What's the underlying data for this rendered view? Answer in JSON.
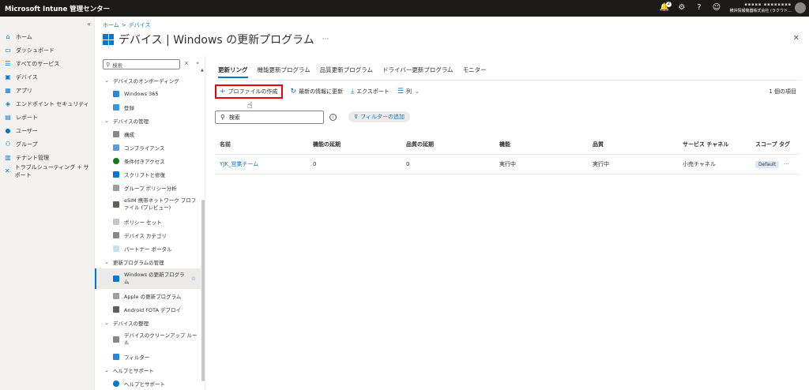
{
  "app": {
    "title": "Microsoft Intune 管理センター",
    "notification_count": "2",
    "user_line1": "▪▪▪▪▪ ▪▪▪▪▪▪▪▪",
    "user_line2": "横浜情報機器株式会社 (ラクウド…"
  },
  "left_nav": {
    "collapse": "«",
    "items": [
      {
        "label": "ホーム",
        "icon": "home-icon"
      },
      {
        "label": "ダッシュボード",
        "icon": "dashboard-icon"
      },
      {
        "label": "すべてのサービス",
        "icon": "list-icon"
      },
      {
        "label": "デバイス",
        "icon": "devices-icon"
      },
      {
        "label": "アプリ",
        "icon": "apps-icon"
      },
      {
        "label": "エンドポイント セキュリティ",
        "icon": "endpoint-security-icon"
      },
      {
        "label": "レポート",
        "icon": "reports-icon"
      },
      {
        "label": "ユーザー",
        "icon": "users-icon"
      },
      {
        "label": "グループ",
        "icon": "groups-icon"
      },
      {
        "label": "テナント管理",
        "icon": "tenant-icon"
      },
      {
        "label": "トラブルシューティング + サポート",
        "icon": "troubleshooting-icon"
      }
    ]
  },
  "breadcrumb": {
    "home": "ホーム",
    "sep": ">",
    "current": "デバイス"
  },
  "page": {
    "title": "デバイス | Windows の更新プログラム",
    "more": "···",
    "close": "✕"
  },
  "blade_nav": {
    "search_placeholder": "検索",
    "search_clear": "x",
    "collapse": "«",
    "sections": {
      "onboarding": "デバイスのオンボーディング",
      "manage": "デバイスの管理",
      "updates": "更新プログラムの管理",
      "organize": "デバイスの整理",
      "help": "ヘルプとサポート"
    },
    "items": {
      "windows365": "Windows 365",
      "enroll": "登録",
      "config": "構成",
      "compliance": "コンプライアンス",
      "conditional": "条件付きアクセス",
      "scripts": "スクリプトと修復",
      "gpa": "グループ ポリシー分析",
      "esim": "eSIM 携帯ネットワーク プロファイル (プレビュー)",
      "policysets": "ポリシー セット",
      "categories": "デバイス カテゴリ",
      "partner": "パートナー ポータル",
      "win_updates": "Windows の更新プログラム",
      "apple_updates": "Apple の更新プログラム",
      "android_fota": "Android FOTA デプロイ",
      "cleanup": "デバイスのクリーンアップ ルール",
      "filters": "フィルター",
      "help_support": "ヘルプとサポート"
    }
  },
  "tabs": [
    "更新リング",
    "機能更新プログラム",
    "品質更新プログラム",
    "ドライバー更新プログラム",
    "モニター"
  ],
  "toolbar": {
    "create_profile": "プロファイルの作成",
    "refresh": "最新の情報に更新",
    "export": "エクスポート",
    "columns": "列",
    "item_count": "1 個の項目"
  },
  "search": {
    "placeholder": "検索"
  },
  "filter": {
    "add": "フィルターの追加"
  },
  "table": {
    "headers": [
      "名前",
      "機能の延期",
      "品質の延期",
      "機能",
      "品質",
      "サービス チャネル",
      "スコープ タグ"
    ],
    "rows": [
      {
        "name": "YJK_営業チーム",
        "feature_defer": "0",
        "quality_defer": "0",
        "feature": "実行中",
        "quality": "実行中",
        "channel": "小売チャネル",
        "scope": "Default"
      }
    ]
  },
  "colors": {
    "accent": "#0078d4",
    "topbar": "#1b1a19",
    "highlight": "#e00000"
  }
}
